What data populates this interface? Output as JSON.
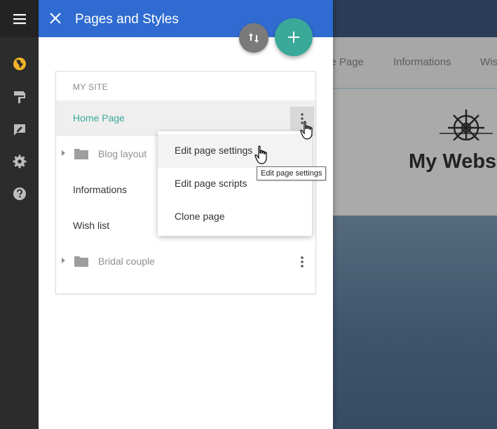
{
  "rail": {
    "icons": [
      "menu-icon",
      "globe-icon",
      "paint-roller-icon",
      "edit-icon",
      "gear-icon",
      "help-icon"
    ],
    "active_color": "#f0b429"
  },
  "drawer": {
    "title": "Pages and Styles",
    "header_color": "#2f6bd0",
    "accent_color": "#3aa99a"
  },
  "site": {
    "section_label": "MY SITE",
    "pages": [
      {
        "label": "Home Page",
        "type": "page",
        "active": true
      },
      {
        "label": "Blog layout",
        "type": "folder"
      },
      {
        "label": "Informations",
        "type": "page"
      },
      {
        "label": "Wish list",
        "type": "page"
      },
      {
        "label": "Bridal couple",
        "type": "folder"
      }
    ]
  },
  "context_menu": {
    "items": [
      {
        "label": "Edit page settings"
      },
      {
        "label": "Edit page scripts"
      },
      {
        "label": "Clone page"
      }
    ]
  },
  "tooltip": {
    "text": "Edit page settings"
  },
  "preview": {
    "nav_items": [
      "ne Page",
      "Informations",
      "Wis"
    ],
    "site_title": "My Webs"
  }
}
